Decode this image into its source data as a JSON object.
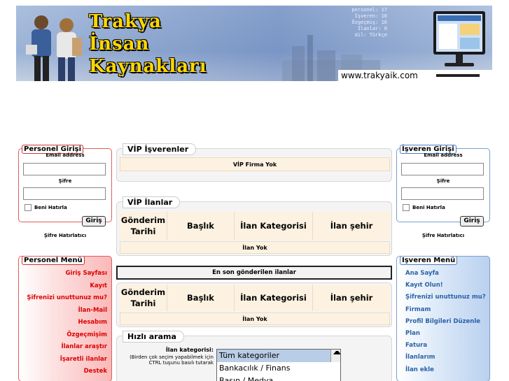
{
  "header": {
    "title_lines": [
      "Trakya",
      "İnsan",
      "Kaynakları"
    ],
    "stats": [
      "personel: 17",
      "İşveren: 10",
      "Özgeçmiş: 16",
      "İlanlar: 0",
      "dil: Türkçe"
    ],
    "url": "www.trakyaik.com"
  },
  "personel_login": {
    "title": "Personel Girişi",
    "email_label": "Email address",
    "password_label": "Şifre",
    "remember_label": "Beni Hatırla",
    "submit_label": "Giriş",
    "forgot_label": "Şifre Hatırlatıcı"
  },
  "isveren_login": {
    "title": "İşveren Girişi",
    "email_label": "Email address",
    "password_label": "Şifre",
    "remember_label": "Beni Hatırla",
    "submit_label": "Giriş",
    "forgot_label": "Şifre Hatırlatıcı"
  },
  "personel_menu": {
    "title": "Personel Menü",
    "items": [
      "Giriş Sayfası",
      "Kayıt",
      "Şifrenizi unuttunuz mu?",
      "İlan-Mail",
      "Hesabım",
      "Özgeçmişim",
      "İlanlar araştır",
      "İşaretli ilanlar",
      "Destek"
    ]
  },
  "isveren_menu": {
    "title": "İşveren Menü",
    "items": [
      "Ana Sayfa",
      "Kayıt Olun!",
      "Şifrenizi unuttunuz mu?",
      "Firmam",
      "Profil Bilgileri Düzenle",
      "Plan",
      "Fatura",
      "İlanlarım",
      "İlan ekle"
    ]
  },
  "vip_isverenler": {
    "title": "VİP İşverenler",
    "empty_text": "VİP Firma Yok"
  },
  "vip_ilanlar": {
    "title": "VİP İlanlar",
    "columns": [
      "Gönderim Tarihi",
      "Başlık",
      "İlan Kategorisi",
      "İlan şehir"
    ],
    "empty_text": "İlan Yok"
  },
  "latest": {
    "title": "En son gönderilen ilanlar",
    "columns": [
      "Gönderim Tarihi",
      "Başlık",
      "İlan Kategorisi",
      "İlan şehir"
    ],
    "empty_text": "İlan Yok"
  },
  "quick_search": {
    "title": "Hızlı arama",
    "category_label": "İlan kategorisi:",
    "hint": "(Birden çok seçim yapabilmek için CTRL tuşunu basılı tutarak",
    "options": [
      "Tüm kategoriler",
      "Bankacılık / Finans",
      "Basın / Medya"
    ],
    "selected": "Tüm kategoriler"
  },
  "colors": {
    "personel_accent": "#dd0000",
    "isveren_accent": "#2b62a8",
    "cream": "#fdf2e1"
  }
}
